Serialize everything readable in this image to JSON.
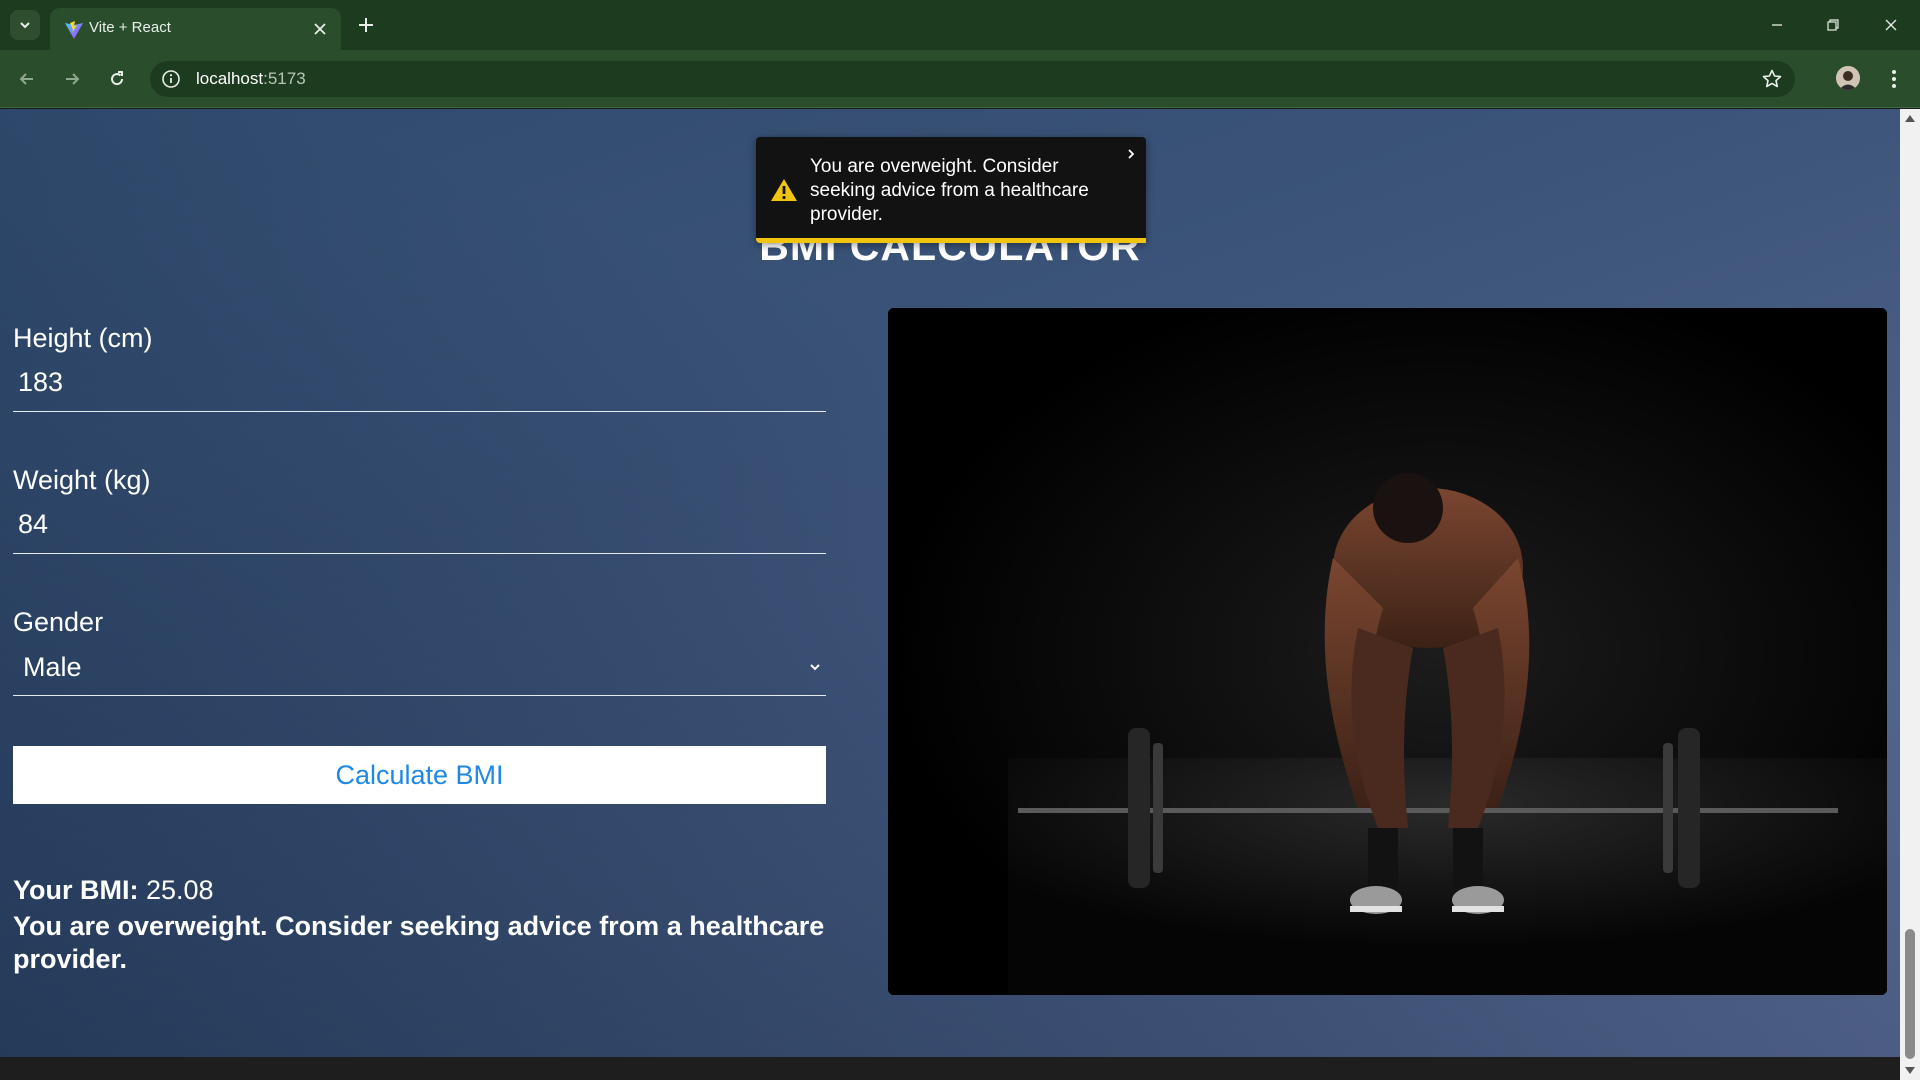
{
  "browser": {
    "tab_title": "Vite + React",
    "url_host": "localhost",
    "url_port": ":5173"
  },
  "page": {
    "title": "BMI CALCULATOR",
    "form": {
      "height_label": "Height (cm)",
      "height_value": "183",
      "weight_label": "Weight (kg)",
      "weight_value": "84",
      "gender_label": "Gender",
      "gender_value": "Male",
      "calculate_label": "Calculate BMI"
    },
    "result": {
      "bmi_label": "Your BMI:",
      "bmi_value": "25.08",
      "message": "You are overweight. Consider seeking advice from a healthcare provider."
    }
  },
  "toast": {
    "message": "You are overweight. Consider seeking advice from a healthcare provider.",
    "accent_color": "#f1c40f",
    "icon": "warning-icon",
    "progress_remaining": 1.0
  },
  "colors": {
    "chrome_dark": "#1d3b1f",
    "chrome": "#2a4d2c",
    "button_text": "#1e88e5"
  }
}
